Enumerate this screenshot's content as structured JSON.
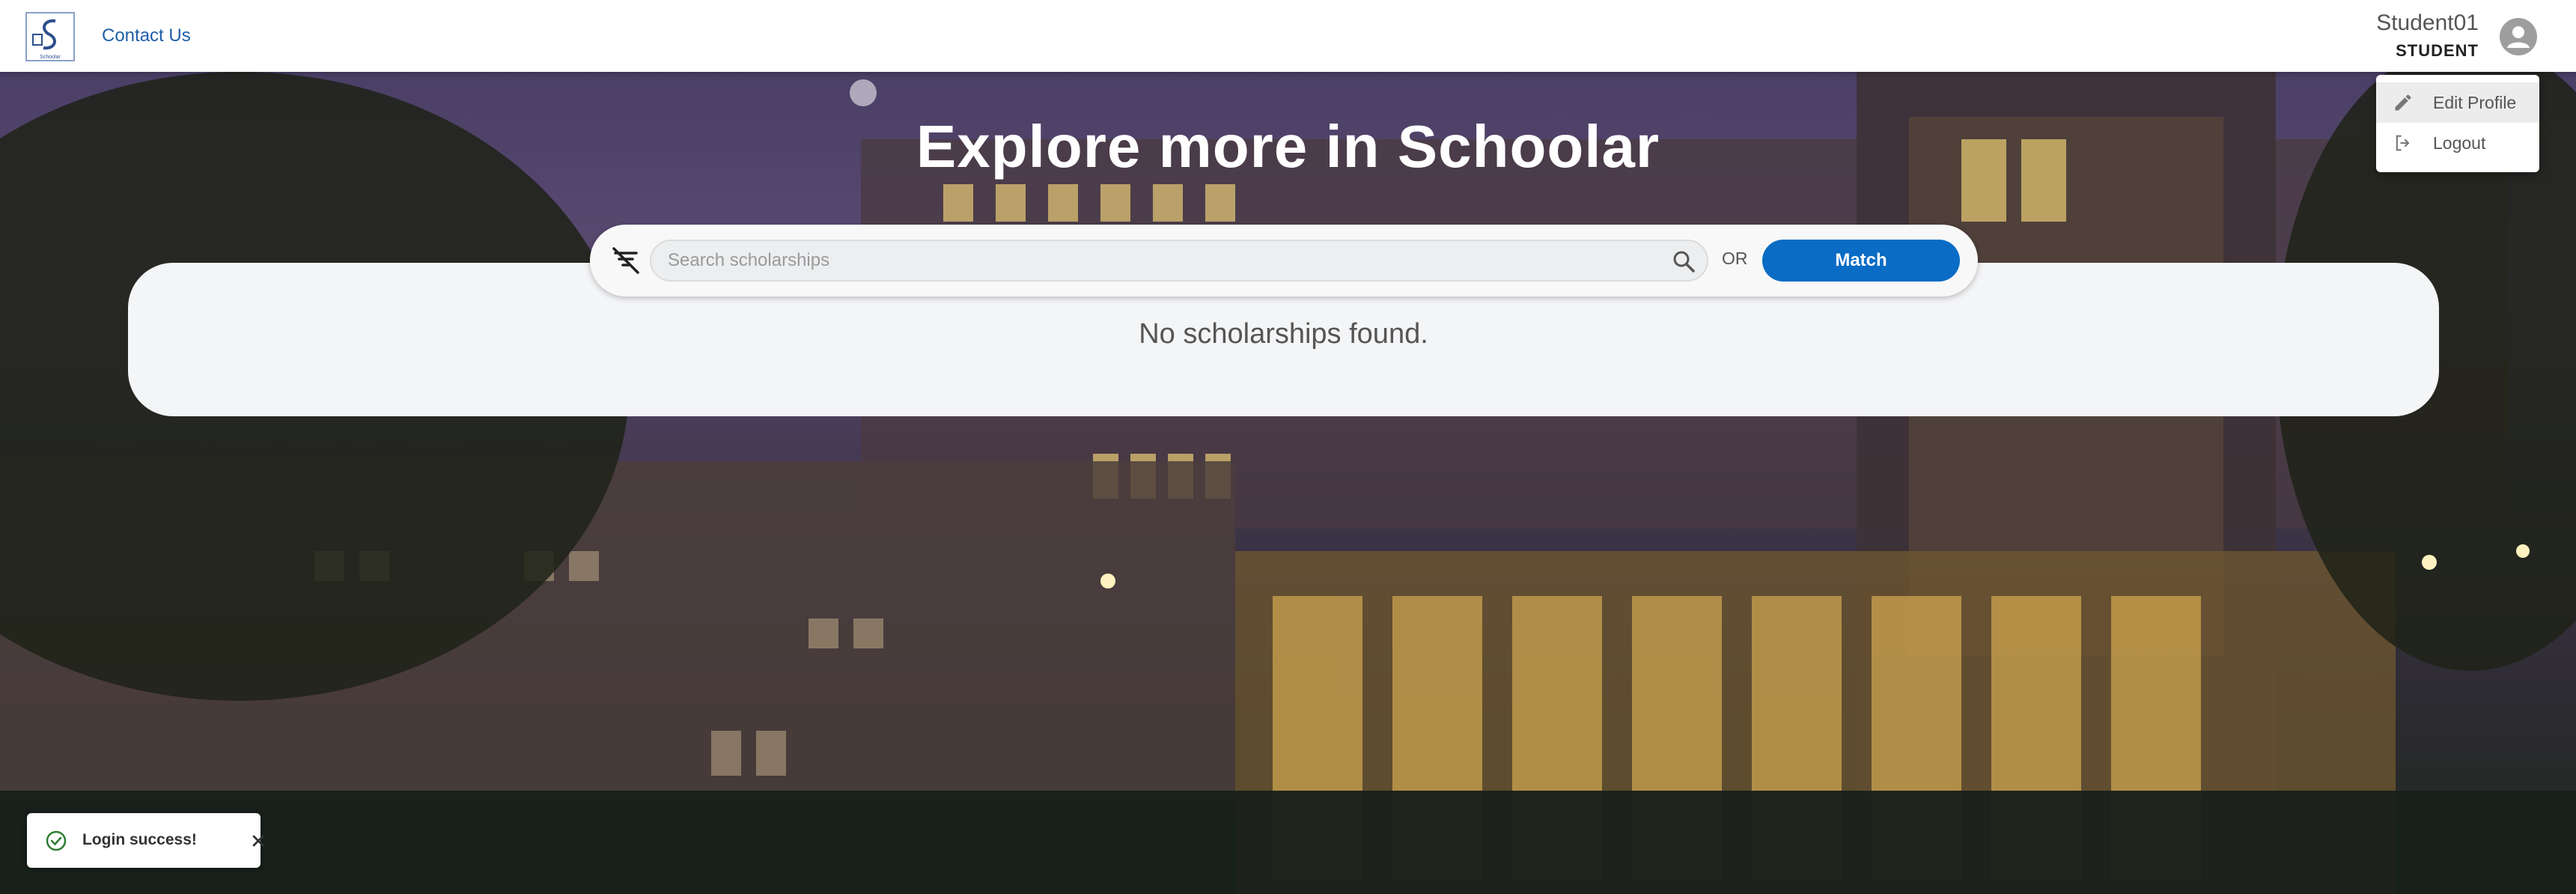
{
  "header": {
    "contact_label": "Contact Us",
    "user_name": "Student01",
    "user_role": "STUDENT"
  },
  "user_menu": {
    "items": [
      {
        "label": "Edit Profile",
        "icon": "pencil-icon"
      },
      {
        "label": "Logout",
        "icon": "logout-icon"
      }
    ]
  },
  "hero": {
    "title": "Explore more in Schoolar"
  },
  "search": {
    "placeholder": "Search scholarships",
    "value": "",
    "or_label": "OR",
    "match_label": "Match"
  },
  "results": {
    "empty_message": "No scholarships found."
  },
  "toast": {
    "message": "Login success!",
    "status_color": "#2e7d32"
  },
  "colors": {
    "accent": "#0a6cc4",
    "link": "#1f5fa8"
  }
}
